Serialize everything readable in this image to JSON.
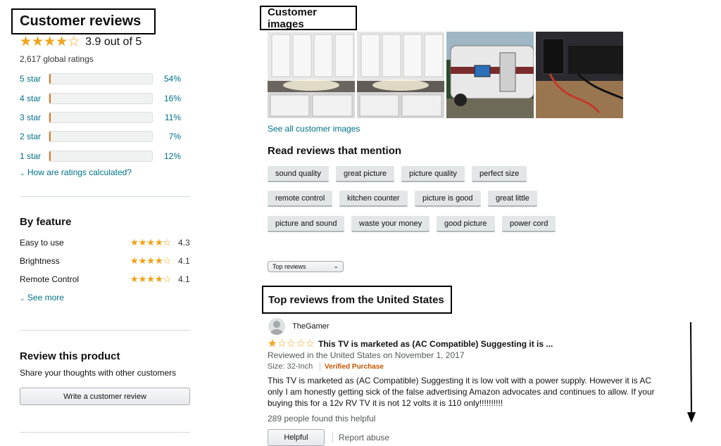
{
  "left": {
    "customer_reviews_title": "Customer reviews",
    "average_rating": 3.9,
    "average_text": "3.9 out of 5",
    "global_ratings": "2,617 global ratings",
    "histogram": [
      {
        "label": "5 star",
        "percent_text": "54%",
        "percent": 54
      },
      {
        "label": "4 star",
        "percent_text": "16%",
        "percent": 16
      },
      {
        "label": "3 star",
        "percent_text": "11%",
        "percent": 11
      },
      {
        "label": "2 star",
        "percent_text": "7%",
        "percent": 7
      },
      {
        "label": "1 star",
        "percent_text": "12%",
        "percent": 12
      }
    ],
    "how_calculated": "How are ratings calculated?",
    "by_feature_title": "By feature",
    "features": [
      {
        "name": "Easy to use",
        "rating": 4.3,
        "value": "4.3"
      },
      {
        "name": "Brightness",
        "rating": 4.1,
        "value": "4.1"
      },
      {
        "name": "Remote Control",
        "rating": 4.1,
        "value": "4.1"
      }
    ],
    "see_more": "See more",
    "review_product_title": "Review this product",
    "share_text": "Share your thoughts with other customers",
    "write_review_button": "Write a customer review"
  },
  "right": {
    "customer_images_title": "Customer images",
    "images": [
      "kitchen-photo",
      "kitchen-photo",
      "rv-trailer-photo",
      "tv-cables-photo"
    ],
    "see_all_images": "See all customer images",
    "mention_title": "Read reviews that mention",
    "chips": [
      [
        "sound quality",
        "great picture",
        "picture quality",
        "perfect size"
      ],
      [
        "remote control",
        "kitchen counter",
        "picture is good",
        "great little"
      ],
      [
        "picture and sound",
        "waste your money",
        "good picture",
        "power cord"
      ]
    ],
    "sort_value": "Top reviews",
    "top_reviews_title": "Top reviews from the United States",
    "review": {
      "reviewer": "TheGamer",
      "rating": 1,
      "headline": "This TV is marketed as (AC Compatible) Suggesting it is ...",
      "date": "Reviewed in the United States on November 1, 2017",
      "size": "Size: 32-Inch",
      "verified": "Verified Purchase",
      "body": "This TV is marketed as (AC Compatible) Suggesting it is low volt with a power supply. However it is AC only I am honestly getting sick of the false advertising Amazon advocates and continues to allow. If your buying this for a 12v RV TV it is not 12 volts it is 110 only!!!!!!!!!!",
      "helpful_count": "289 people found this helpful",
      "helpful_button": "Helpful",
      "report": "Report abuse"
    }
  },
  "colors": {
    "star": "#f0a41c",
    "bar_fill": "#f8a62b",
    "link": "#007185",
    "verified": "#c45500"
  }
}
